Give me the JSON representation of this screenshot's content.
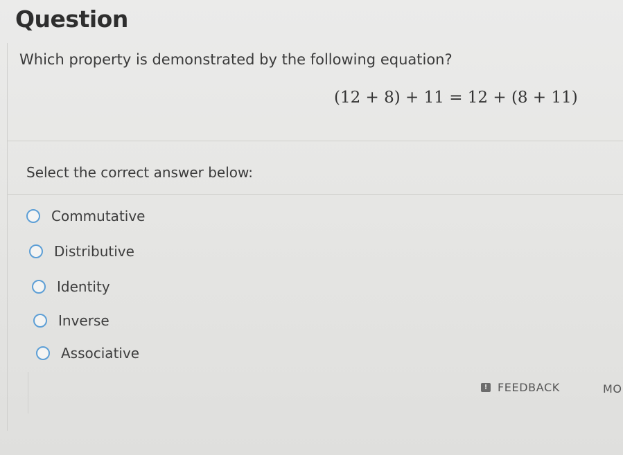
{
  "question": {
    "heading": "Question",
    "prompt": "Which property is demonstrated by the following equation?",
    "equation": "(12 + 8) + 11 = 12 + (8 + 11)"
  },
  "answers": {
    "select_label": "Select the correct answer below:",
    "options": [
      {
        "label": "Commutative",
        "selected": false
      },
      {
        "label": "Distributive",
        "selected": false
      },
      {
        "label": "Identity",
        "selected": false
      },
      {
        "label": "Inverse",
        "selected": false
      },
      {
        "label": "Associative",
        "selected": false
      }
    ]
  },
  "footer": {
    "feedback_label": "FEEDBACK",
    "feedback_icon": "feedback-icon",
    "more_label": "MO"
  },
  "colors": {
    "radio_border": "#5d9fd6",
    "background": "#e6e6e4"
  }
}
